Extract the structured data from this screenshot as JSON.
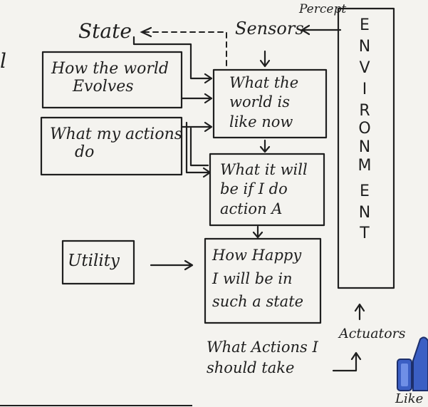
{
  "edge_fragment": "l",
  "state_label": "State",
  "sensors_label": "Sensors",
  "percept_label": "Percept",
  "environment_letters": [
    "E",
    "N",
    "V",
    "I",
    "R",
    "O",
    "N",
    "M",
    "E",
    "N",
    "T"
  ],
  "box_world_evolves": [
    "How the world",
    "Evolves"
  ],
  "box_actions_do": [
    "What my actions",
    "do"
  ],
  "box_world_now": [
    "What the",
    "world is",
    "like now"
  ],
  "box_action_a": [
    "What it will",
    "be if I do",
    "action A"
  ],
  "box_utility": "Utility",
  "box_happy": [
    "How Happy",
    "I will be in",
    "such a state"
  ],
  "actions_text": [
    "What Actions I",
    "should take"
  ],
  "actuators_label": "Actuators",
  "corner_label": "Like"
}
